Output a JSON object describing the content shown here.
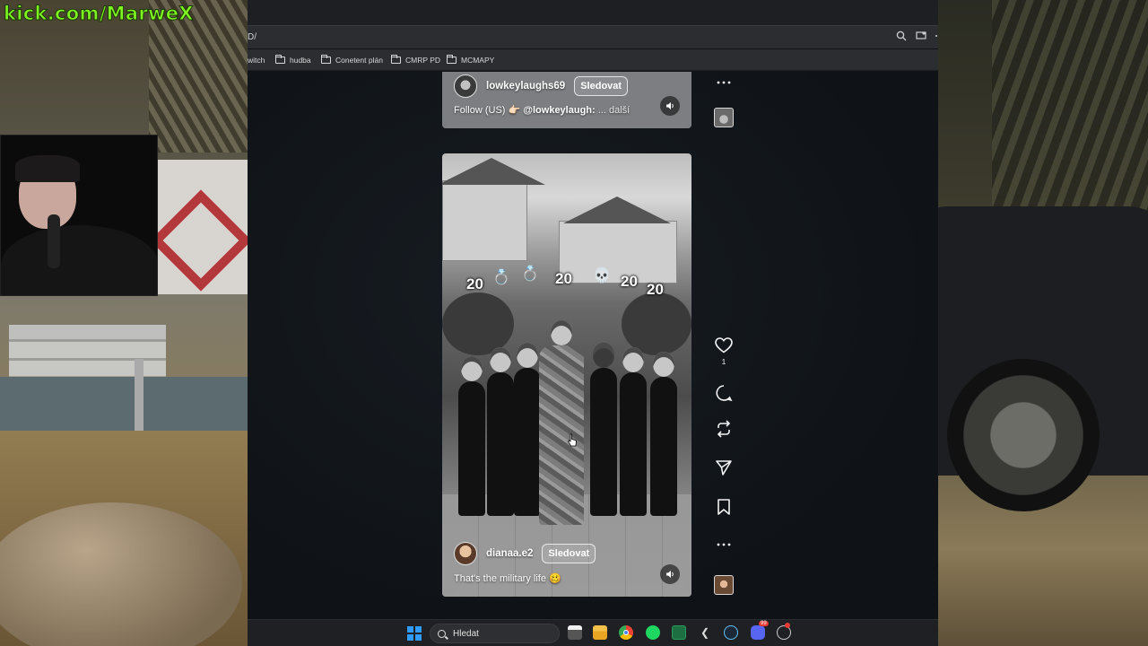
{
  "stream": {
    "url_overlay": "kick.com/MarweX"
  },
  "browser": {
    "address_fragment": "D/",
    "bookmarks": [
      {
        "label": "witch",
        "folder": false
      },
      {
        "label": "hudba",
        "folder": true
      },
      {
        "label": "Conetent plán",
        "folder": true
      },
      {
        "label": "CMRP PD",
        "folder": true
      },
      {
        "label": "MCMAPY",
        "folder": true
      }
    ]
  },
  "posts": [
    {
      "username": "lowkeylaughs69",
      "follow_label": "Sledovat",
      "caption_start": "Follow (US) 👉🏻 ",
      "caption_tag": "@lowkeylaugh:",
      "caption_more": " ... další"
    },
    {
      "username": "dianaa.e2",
      "follow_label": "Sledovat",
      "caption": "That's the military life 🥴",
      "overlay_labels": [
        "20",
        "20",
        "20",
        "20"
      ],
      "overlay_emojis": [
        "💍",
        "💍",
        "💀"
      ]
    }
  ],
  "actions": {
    "like_count": "1"
  },
  "taskbar": {
    "search_placeholder": "Hledat",
    "notification_badge": "99"
  },
  "colors": {
    "stream_text": "#7ef522",
    "browser_bg": "#0f1317",
    "taskbar_bg": "#1f2024"
  }
}
